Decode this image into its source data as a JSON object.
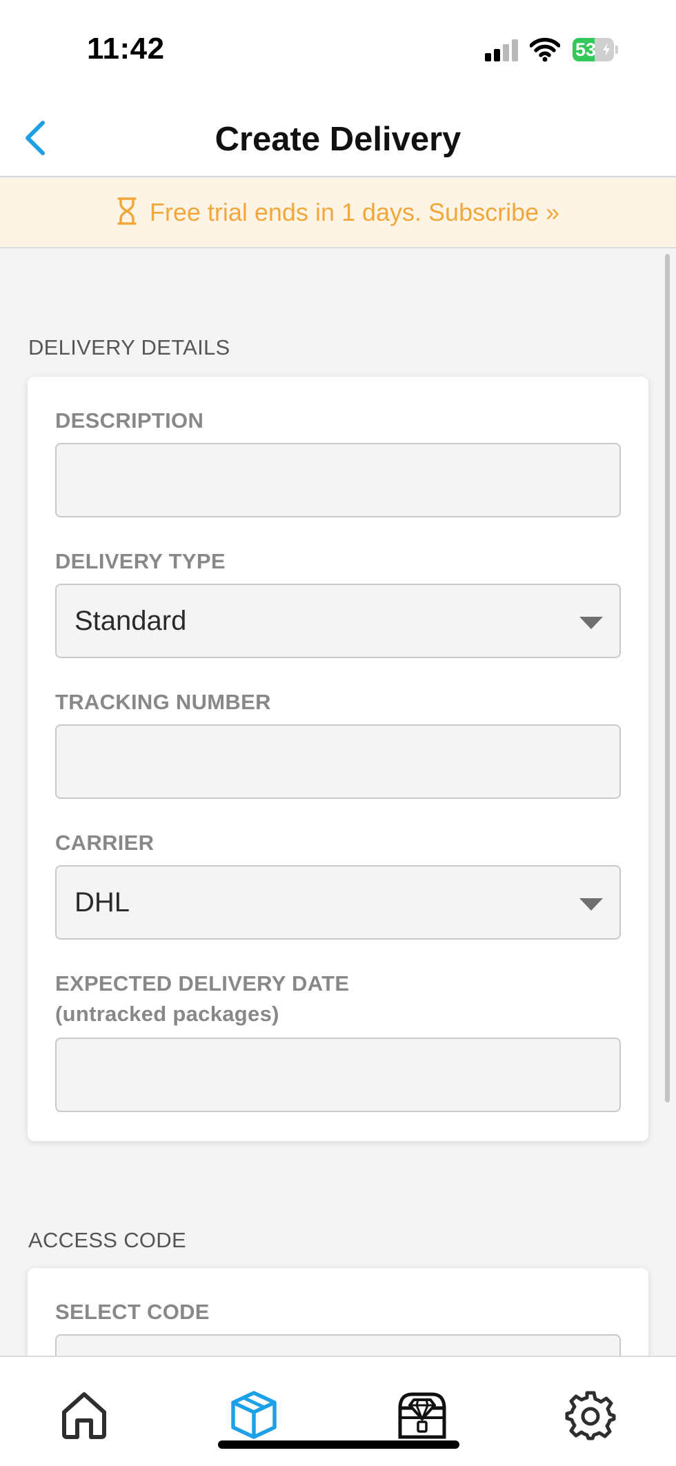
{
  "status_bar": {
    "time": "11:42",
    "battery_level": "53",
    "battery_fraction": 0.53,
    "battery_charging": true,
    "signal_bars_active": 2,
    "signal_bars_total": 4
  },
  "nav": {
    "title": "Create Delivery",
    "back_icon": "chevron-left-icon"
  },
  "banner": {
    "text": "Free trial ends in 1 days. Subscribe »",
    "icon": "hourglass-icon"
  },
  "sections": {
    "delivery_details": {
      "header": "DELIVERY DETAILS",
      "description": {
        "label": "DESCRIPTION",
        "value": ""
      },
      "delivery_type": {
        "label": "DELIVERY TYPE",
        "value": "Standard"
      },
      "tracking_number": {
        "label": "TRACKING NUMBER",
        "value": ""
      },
      "carrier": {
        "label": "CARRIER",
        "value": "DHL"
      },
      "expected_date": {
        "label": "EXPECTED DELIVERY DATE",
        "sublabel": "(untracked packages)",
        "value": ""
      }
    },
    "access_code": {
      "header": "ACCESS CODE",
      "select_code": {
        "label": "SELECT CODE",
        "value": ""
      }
    }
  },
  "tab_bar": {
    "tabs": [
      {
        "icon": "home-icon",
        "active": false
      },
      {
        "icon": "package-icon",
        "active": true
      },
      {
        "icon": "treasure-chest-icon",
        "active": false
      },
      {
        "icon": "gear-icon",
        "active": false
      }
    ]
  },
  "colors": {
    "accent": "#1da1e6",
    "banner_text": "#f0a83a",
    "banner_bg": "#fef4e6",
    "battery_green": "#34c759"
  }
}
